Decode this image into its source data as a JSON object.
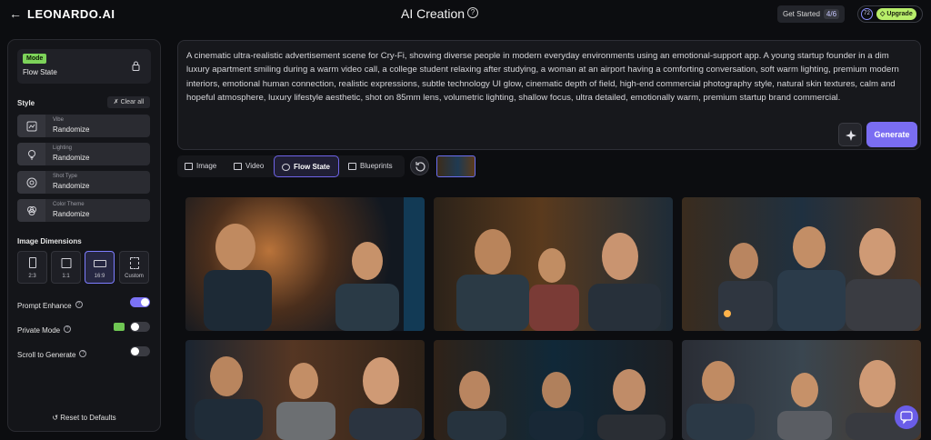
{
  "header": {
    "back_icon": "arrow-left-icon",
    "logo": "LEONARDO.AI",
    "title": "AI Creation",
    "get_started_label": "Get Started",
    "get_started_count": "4/6",
    "token_count": "72",
    "upgrade_label": "Upgrade"
  },
  "sidebar": {
    "mode_tag": "Mode",
    "mode_value": "Flow State",
    "style_heading": "Style",
    "clear_all": "Clear all",
    "style_rows": [
      {
        "name": "Vibe",
        "value": "Randomize",
        "icon": "vibe-icon"
      },
      {
        "name": "Lighting",
        "value": "Randomize",
        "icon": "lightbulb-icon"
      },
      {
        "name": "Shot Type",
        "value": "Randomize",
        "icon": "aperture-icon"
      },
      {
        "name": "Color Theme",
        "value": "Randomize",
        "icon": "palette-icon"
      }
    ],
    "dimensions_heading": "Image Dimensions",
    "dimensions": [
      {
        "label": "2:3",
        "active": false
      },
      {
        "label": "1:1",
        "active": false
      },
      {
        "label": "16:9",
        "active": true
      },
      {
        "label": "Custom",
        "active": false
      }
    ],
    "prompt_enhance_label": "Prompt Enhance",
    "prompt_enhance_on": true,
    "private_mode_label": "Private Mode",
    "private_mode_on": false,
    "scroll_to_generate_label": "Scroll to Generate",
    "scroll_to_generate_on": false,
    "reset_label": "Reset to Defaults"
  },
  "prompt": {
    "text": "A cinematic ultra-realistic advertisement scene for Cry-Fi, showing diverse people in modern everyday environments using an emotional-support app. A young startup founder in a dim luxury apartment smiling during a warm video call, a college student relaxing after studying, a woman at an airport having a comforting conversation, soft warm lighting, premium modern interiors, emotional human connection, realistic expressions, subtle technology UI glow, cinematic depth of field, high-end commercial photography style, natural skin textures, calm and hopeful atmosphere, luxury lifestyle aesthetic, shot on 85mm lens, volumetric lighting, shallow focus, ultra detailed, emotionally warm, premium startup brand commercial.",
    "generate_label": "Generate"
  },
  "tabs": [
    {
      "label": "Image",
      "active": false
    },
    {
      "label": "Video",
      "active": false
    },
    {
      "label": "Flow State",
      "active": true
    },
    {
      "label": "Blueprints",
      "active": false
    }
  ],
  "colors": {
    "accent": "#7a6df2",
    "mode_green": "#7dd35a",
    "upgrade_green": "#b8ee6a"
  }
}
